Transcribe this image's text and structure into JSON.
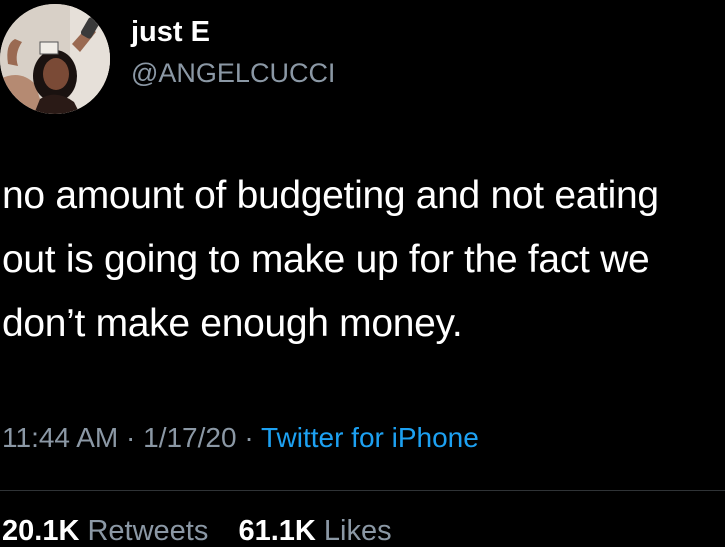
{
  "user": {
    "display_name": "just E",
    "handle": "@ANGELCUCCI",
    "avatar_icon": "profile-photo"
  },
  "tweet": {
    "lines": [
      "no amount of budgeting and not eating",
      "out is going to make up for the fact we",
      "don’t make enough money."
    ]
  },
  "meta": {
    "time": "11:44 AM",
    "separator": "·",
    "date": "1/17/20",
    "source": "Twitter for iPhone"
  },
  "stats": {
    "retweets_count": "20.1K",
    "retweets_label": "Retweets",
    "likes_count": "61.1K",
    "likes_label": "Likes"
  },
  "colors": {
    "background": "#000000",
    "primary_text": "#ffffff",
    "secondary_text": "#8b98a5",
    "accent": "#1da1f2"
  }
}
